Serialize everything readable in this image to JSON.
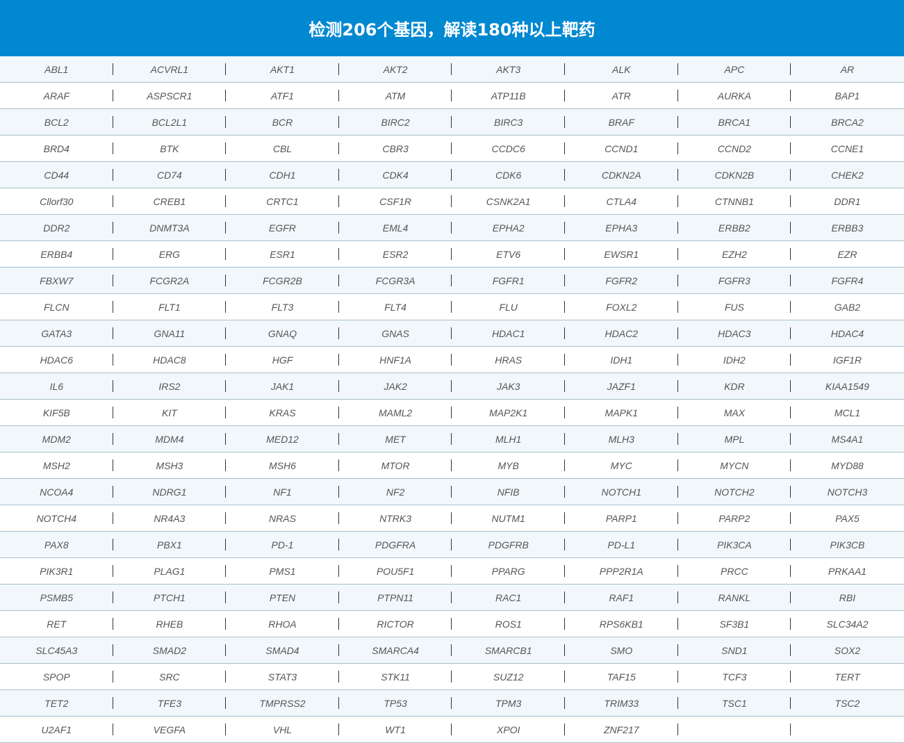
{
  "header": {
    "title": "检测206个基因，解读180种以上靶药"
  },
  "colors": {
    "header_bg": "#0088d1",
    "row_alt_bg": "#f1f7fb",
    "row_border": "#a8bfcc"
  },
  "genes": [
    [
      "ABL1",
      "ACVRL1",
      "AKT1",
      "AKT2",
      "AKT3",
      "ALK",
      "APC",
      "AR"
    ],
    [
      "ARAF",
      "ASPSCR1",
      "ATF1",
      "ATM",
      "ATP11B",
      "ATR",
      "AURKA",
      "BAP1"
    ],
    [
      "BCL2",
      "BCL2L1",
      "BCR",
      "BIRC2",
      "BIRC3",
      "BRAF",
      "BRCA1",
      "BRCA2"
    ],
    [
      "BRD4",
      "BTK",
      "CBL",
      "CBR3",
      "CCDC6",
      "CCND1",
      "CCND2",
      "CCNE1"
    ],
    [
      "CD44",
      "CD74",
      "CDH1",
      "CDK4",
      "CDK6",
      "CDKN2A",
      "CDKN2B",
      "CHEK2"
    ],
    [
      "Cllorf30",
      "CREB1",
      "CRTC1",
      "CSF1R",
      "CSNK2A1",
      "CTLA4",
      "CTNNB1",
      "DDR1"
    ],
    [
      "DDR2",
      "DNMT3A",
      "EGFR",
      "EML4",
      "EPHA2",
      "EPHA3",
      "ERBB2",
      "ERBB3"
    ],
    [
      "ERBB4",
      "ERG",
      "ESR1",
      "ESR2",
      "ETV6",
      "EWSR1",
      "EZH2",
      "EZR"
    ],
    [
      "FBXW7",
      "FCGR2A",
      "FCGR2B",
      "FCGR3A",
      "FGFR1",
      "FGFR2",
      "FGFR3",
      "FGFR4"
    ],
    [
      "FLCN",
      "FLT1",
      "FLT3",
      "FLT4",
      "FLU",
      "FOXL2",
      "FUS",
      "GAB2"
    ],
    [
      "GATA3",
      "GNA11",
      "GNAQ",
      "GNAS",
      "HDAC1",
      "HDAC2",
      "HDAC3",
      "HDAC4"
    ],
    [
      "HDAC6",
      "HDAC8",
      "HGF",
      "HNF1A",
      "HRAS",
      "IDH1",
      "IDH2",
      "IGF1R"
    ],
    [
      "IL6",
      "IRS2",
      "JAK1",
      "JAK2",
      "JAK3",
      "JAZF1",
      "KDR",
      "KIAA1549"
    ],
    [
      "KIF5B",
      "KIT",
      "KRAS",
      "MAML2",
      "MAP2K1",
      "MAPK1",
      "MAX",
      "MCL1"
    ],
    [
      "MDM2",
      "MDM4",
      "MED12",
      "MET",
      "MLH1",
      "MLH3",
      "MPL",
      "MS4A1"
    ],
    [
      "MSH2",
      "MSH3",
      "MSH6",
      "MTOR",
      "MYB",
      "MYC",
      "MYCN",
      "MYD88"
    ],
    [
      "NCOA4",
      "NDRG1",
      "NF1",
      "NF2",
      "NFIB",
      "NOTCH1",
      "NOTCH2",
      "NOTCH3"
    ],
    [
      "NOTCH4",
      "NR4A3",
      "NRAS",
      "NTRK3",
      "NUTM1",
      "PARP1",
      "PARP2",
      "PAX5"
    ],
    [
      "PAX8",
      "PBX1",
      "PD-1",
      "PDGFRA",
      "PDGFRB",
      "PD-L1",
      "PIK3CA",
      "PIK3CB"
    ],
    [
      "PIK3R1",
      "PLAG1",
      "PMS1",
      "POU5F1",
      "PPARG",
      "PPP2R1A",
      "PRCC",
      "PRKAA1"
    ],
    [
      "PSMB5",
      "PTCH1",
      "PTEN",
      "PTPN11",
      "RAC1",
      "RAF1",
      "RANKL",
      "RBI"
    ],
    [
      "RET",
      "RHEB",
      "RHOA",
      "RICTOR",
      "ROS1",
      "RPS6KB1",
      "SF3B1",
      "SLC34A2"
    ],
    [
      "SLC45A3",
      "SMAD2",
      "SMAD4",
      "SMARCA4",
      "SMARCB1",
      "SMO",
      "SND1",
      "SOX2"
    ],
    [
      "SPOP",
      "SRC",
      "STAT3",
      "STK11",
      "SUZ12",
      "TAF15",
      "TCF3",
      "TERT"
    ],
    [
      "TET2",
      "TFE3",
      "TMPRSS2",
      "TP53",
      "TPM3",
      "TRIM33",
      "TSC1",
      "TSC2"
    ],
    [
      "U2AF1",
      "VEGFA",
      "VHL",
      "WT1",
      "XPOI",
      "ZNF217",
      "",
      ""
    ]
  ]
}
